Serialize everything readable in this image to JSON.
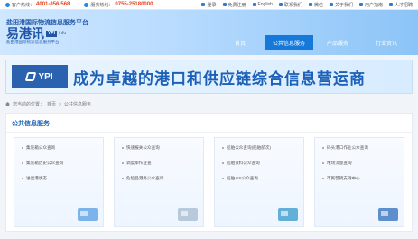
{
  "topbar": {
    "phone1_label": "客户热线：",
    "phone1": "4001-856-568",
    "phone2_label": "服务热线：",
    "phone2": "0755-25180000",
    "links": [
      "登录",
      "免费注册",
      "English",
      "联系我们",
      "微信",
      "关于我们",
      "用户指南",
      "人才招聘"
    ]
  },
  "header": {
    "title_cn": "盐田港国际物流信息服务平台",
    "brand": "易港讯",
    "brand_tag": "YPI",
    "brand_info": "info",
    "brand_sub": "盐田港国际物流信息服务平台",
    "nav": [
      {
        "label": "首页",
        "active": false
      },
      {
        "label": "公共信息服务",
        "active": true
      },
      {
        "label": "产品服务",
        "active": false
      },
      {
        "label": "行业资讯",
        "active": false
      }
    ]
  },
  "banner": {
    "logo_text": "YPI",
    "slogan": "成为卓越的港口和供应链综合信息营运商"
  },
  "breadcrumb": {
    "prefix": "您当前的位置：",
    "home": "首页",
    "sep": ">",
    "current": "公共信息服务"
  },
  "panel": {
    "title": "公共信息服务",
    "cards": [
      {
        "items": [
          "集装箱公众查询",
          "集装箱历史公众查询",
          "进出港状态"
        ],
        "color": "#7bb3ea"
      },
      {
        "items": [
          "快速报关公众查询",
          "调度单作业查",
          "危险品港务公众查询"
        ],
        "color": "#b8c9dc"
      },
      {
        "items": [
          "船舶公众查询(船舶航次)",
          "船舶资料公众查询",
          "船舶AIS公众查询"
        ],
        "color": "#62b0d8"
      },
      {
        "items": [
          "码头港口作业公众查询",
          "堆场流量查询",
          "市民营销支持中心"
        ],
        "color": "#5c8fcc"
      }
    ]
  }
}
